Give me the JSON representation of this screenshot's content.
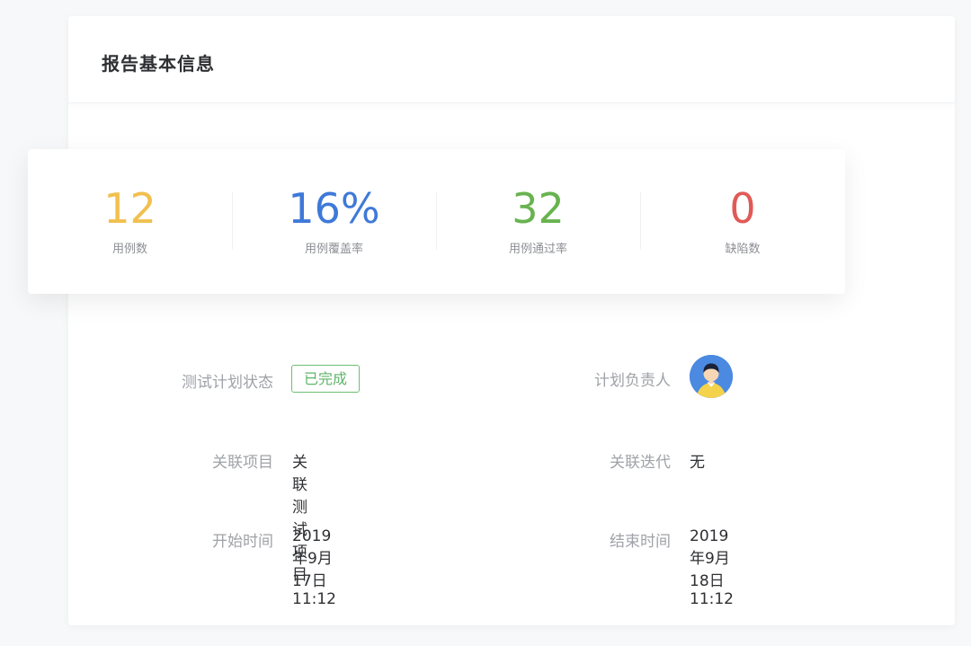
{
  "card": {
    "title": "报告基本信息"
  },
  "stats": [
    {
      "value": "12",
      "label": "用例数",
      "color": "#f1c04f"
    },
    {
      "value": "16%",
      "label": "用例覆盖率",
      "color": "#3e79d8"
    },
    {
      "value": "32",
      "label": "用例通过率",
      "color": "#68b34f"
    },
    {
      "value": "0",
      "label": "缺陷数",
      "color": "#e05a57"
    }
  ],
  "details": {
    "plan_status_label": "测试计划状态",
    "plan_status_value": "已完成",
    "owner_label": "计划负责人",
    "project_label": "关联项目",
    "project_value": "关联测试项目",
    "iteration_label": "关联迭代",
    "iteration_value": "无",
    "start_label": "开始时间",
    "start_value": "2019年9月17日 11:12",
    "end_label": "结束时间",
    "end_value": "2019年9月18日 11:12"
  },
  "colors": {
    "status_green": "#5fb36a",
    "avatar_blue": "#4b8ae0",
    "avatar_yellow": "#f4d24b"
  }
}
